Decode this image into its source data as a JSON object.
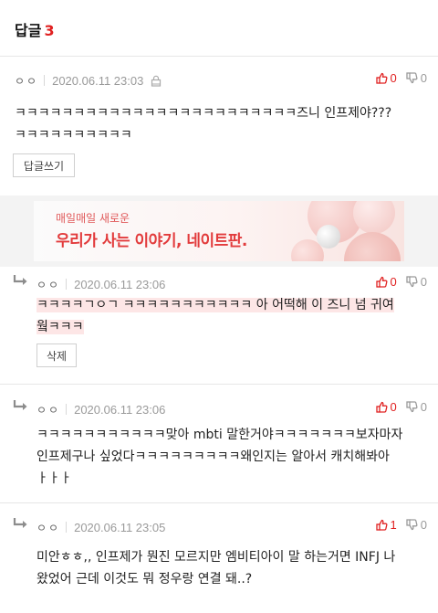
{
  "header": {
    "title": "답글",
    "count": "3"
  },
  "main_comment": {
    "author": "ㅇㅇ",
    "date": "2020.06.11 23:03",
    "up": "0",
    "down": "0",
    "text_line1": "ㅋㅋㅋㅋㅋㅋㅋㅋㅋㅋㅋㅋㅋㅋㅋㅋㅋㅋㅋㅋㅋㅋㅋㅋ즈니 인프제야???",
    "text_line2": "ㅋㅋㅋㅋㅋㅋㅋㅋㅋㅋ",
    "reply_button": "답글쓰기"
  },
  "banner": {
    "subtitle": "매일매일 새로운",
    "title": "우리가 사는 이야기, 네이트판."
  },
  "replies": [
    {
      "author": "ㅇㅇ",
      "date": "2020.06.11 23:06",
      "up": "0",
      "down": "0",
      "text_line1": "ㅋㅋㅋㅋㄱㅇㄱ ㅋㅋㅋㅋㅋㅋㅋㅋㅋㅋㅋ 아 어떡해 이 즈니 넘 귀여",
      "text_line2": "웤ㅋㅋㅋ",
      "delete_button": "삭제"
    },
    {
      "author": "ㅇㅇ",
      "date": "2020.06.11 23:06",
      "up": "0",
      "down": "0",
      "text_line1": "ㅋㅋㅋㅋㅋㅋㅋㅋㅋㅋㅋ맞아 mbti 말한거야ㅋㅋㅋㅋㅋㅋㅋ보자마자",
      "text_line2": "인프제구나 싶었다ㅋㅋㅋㅋㅋㅋㅋㅋㅋ왜인지는 알아서 캐치해봐아",
      "text_line3": "ㅏㅏㅏ"
    },
    {
      "author": "ㅇㅇ",
      "date": "2020.06.11 23:05",
      "up": "1",
      "down": "0",
      "text_line1": "미안ㅎㅎ,, 인프제가 뭔진 모르지만 엠비티아이 말 하는거면 INFJ 나",
      "text_line2": "왔었어 근데 이것도 뭐 정우랑 연결 돼..?"
    }
  ],
  "colors": {
    "accent": "#e02020",
    "highlight": "#fde6e6",
    "banner_red": "#e23b3c"
  },
  "icons": [
    "lock-icon",
    "thumbs-up-icon",
    "thumbs-down-icon",
    "reply-arrow-icon"
  ]
}
